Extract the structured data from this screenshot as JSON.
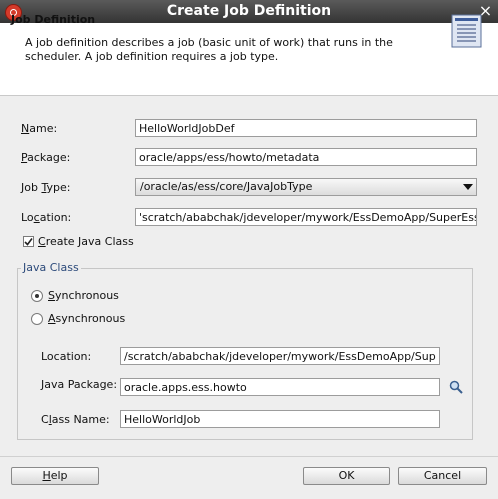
{
  "window": {
    "title": "Create Job Definition",
    "close_glyph": "×"
  },
  "header": {
    "title": "Job Definition",
    "description": "A job definition describes a job (basic unit of work) that runs in the scheduler.  A job definition requires a job type."
  },
  "form": {
    "name": {
      "label_u": "N",
      "label_rest": "ame:",
      "value": "HelloWorldJobDef"
    },
    "package": {
      "label_u": "P",
      "label_rest": "ackage:",
      "value": "oracle/apps/ess/howto/metadata"
    },
    "job_type": {
      "label_pre": "Job ",
      "label_u": "T",
      "label_rest": "ype:",
      "value": "/oracle/as/ess/core/JavaJobType"
    },
    "location": {
      "label_pre": "Lo",
      "label_u": "c",
      "label_rest": "ation:",
      "value": "'scratch/ababchak/jdeveloper/mywork/EssDemoApp/SuperEss"
    },
    "create_java_class": {
      "label_u": "C",
      "label_rest": "reate Java Class",
      "checked": true
    }
  },
  "java_class": {
    "group_label": "Java Class",
    "synchronous": {
      "label_u": "S",
      "label_rest": "ynchronous",
      "selected": true
    },
    "asynchronous": {
      "label_u": "A",
      "label_rest": "synchronous",
      "selected": false
    },
    "location": {
      "label": "Location:",
      "value": "/scratch/ababchak/jdeveloper/mywork/EssDemoApp/Sup"
    },
    "java_package": {
      "label": "Java Package:",
      "value": "oracle.apps.ess.howto",
      "search_icon": "search-icon"
    },
    "class_name": {
      "label_pre": "C",
      "label_u": "l",
      "label_rest": "ass Name:",
      "value": "HelloWorldJob"
    }
  },
  "buttons": {
    "help": {
      "label_u": "H",
      "label_rest": "elp"
    },
    "ok": {
      "label": "OK"
    },
    "cancel": {
      "label": "Cancel"
    }
  }
}
